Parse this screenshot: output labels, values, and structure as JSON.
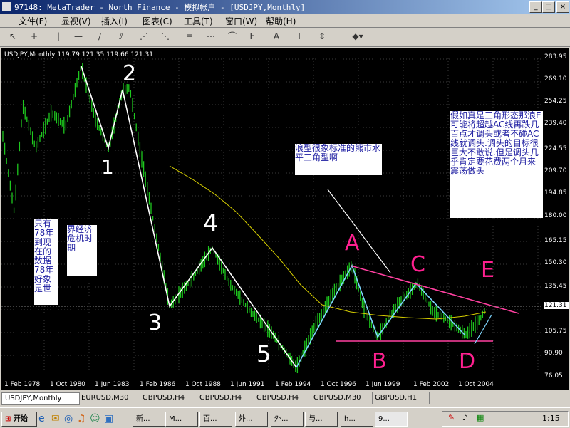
{
  "window": {
    "title": "97148: MetaTrader - North Finance - 模拟帐户 - [USDJPY,Monthly]",
    "min": "_",
    "max": "□",
    "close": "×"
  },
  "menu": [
    "文件(F)",
    "显视(V)",
    "插入(I)",
    "图表(C)",
    "工具(T)",
    "窗口(W)",
    "帮助(H)"
  ],
  "chart_header": "USDJPY,Monthly  119.79 121.35 119.66 121.31",
  "price_axis": [
    "283.95",
    "269.10",
    "254.25",
    "239.40",
    "224.55",
    "209.70",
    "194.85",
    "180.00",
    "165.15",
    "150.30",
    "135.45",
    "121.31",
    "105.75",
    "90.90",
    "76.05"
  ],
  "current_price": "121.31",
  "time_axis": [
    "1 Feb 1978",
    "1 Oct 1980",
    "1 Jun 1983",
    "1 Feb 1986",
    "1 Oct 1988",
    "1 Jun 1991",
    "1 Feb 1994",
    "1 Oct 1996",
    "1 Jun 1999",
    "1 Feb 2002",
    "1 Oct 2004"
  ],
  "wave_labels": {
    "w1": "1",
    "w2": "2",
    "w3": "3",
    "w4": "4",
    "w5": "5",
    "A": "A",
    "B": "B",
    "C": "C",
    "D": "D",
    "E": "E"
  },
  "notes": {
    "left1": "只有78年到现在的数据78年好象是世",
    "left2": "界经济危机时期",
    "middle": "浪型很象标准的熊市水平三角型啊",
    "right": "假如真是三角形态那浪E可能将超越AC线再跌几百点才调头或者不碰AC线就调头.调头的目标很巨大不敢说.但是调头几乎肯定要花费两个月来震荡做头"
  },
  "tabs": [
    "USDJPY,Monthly",
    "EURUSD,M30",
    "GBPUSD,H4",
    "GBPUSD,H4",
    "GBPUSD,H4",
    "GBPUSD,M30",
    "GBPUSD,H1"
  ],
  "taskbar": {
    "start": "开始",
    "tasks": [
      "新...",
      "M...",
      "百...",
      "外...",
      "外...",
      "与...",
      "h...",
      "9..."
    ],
    "clock": "1:15"
  },
  "colors": {
    "bars": "#1ec81e",
    "ma": "#d8d000",
    "wave": "#ffffff",
    "triangle": "#ff40a0",
    "cyan": "#7fd7ff",
    "label_pink": "#ff2090"
  }
}
